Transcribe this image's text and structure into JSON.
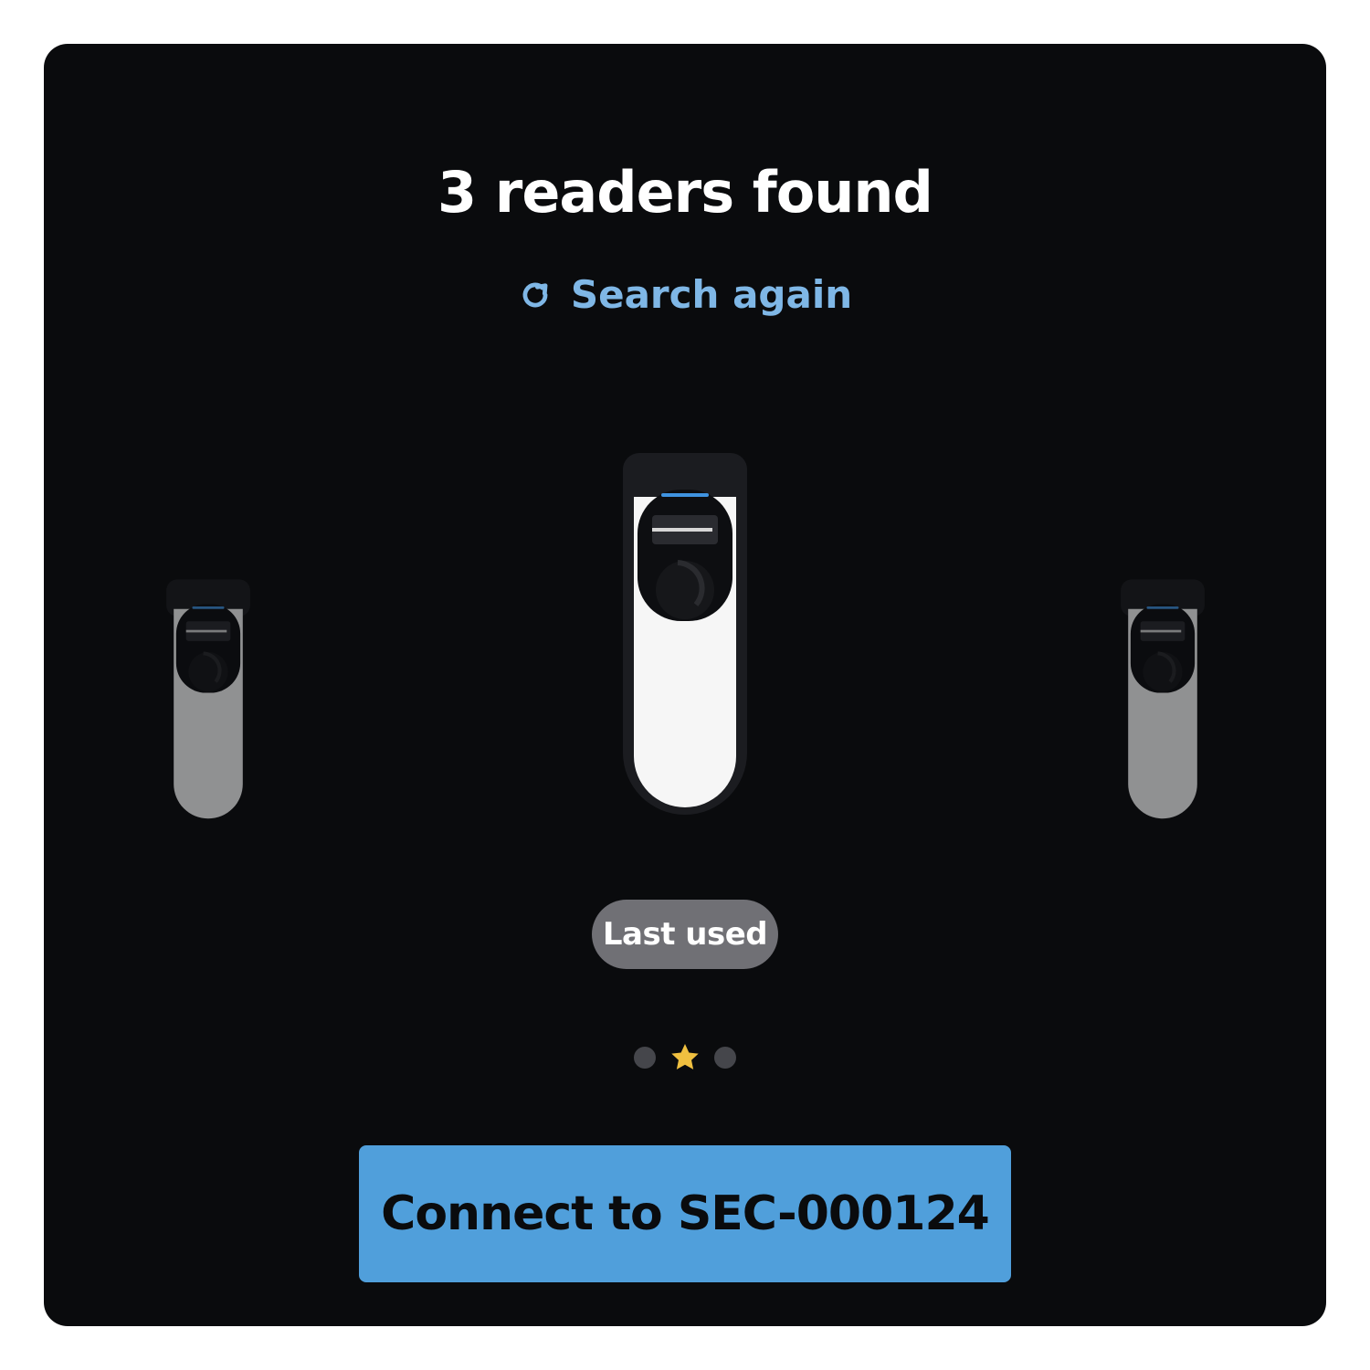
{
  "header": {
    "title": "3 readers found"
  },
  "actions": {
    "search_again_label": "Search again",
    "search_again_icon": "refresh-icon"
  },
  "carousel": {
    "readers_count": 3,
    "selected_index": 1,
    "selected_badge": "Last used",
    "indicator_icons": [
      "dot",
      "star-icon",
      "dot"
    ],
    "colors": {
      "accent": "#509fdb",
      "link": "#7fb7e6",
      "star": "#f0c040",
      "badge_bg": "#707075",
      "panel_bg": "#0a0b0d"
    }
  },
  "footer": {
    "connect_label": "Connect to SEC-000124"
  }
}
